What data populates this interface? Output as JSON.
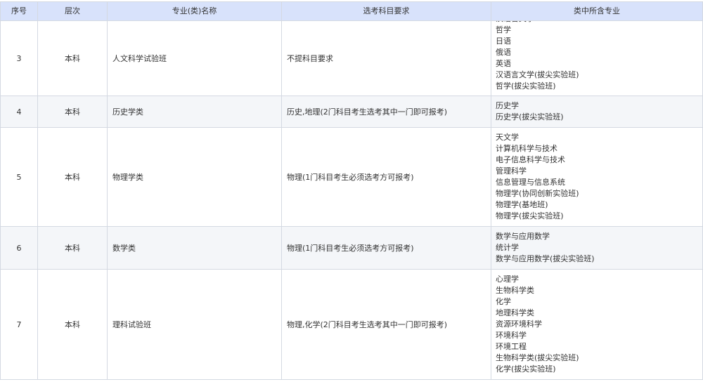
{
  "table": {
    "headers": [
      "序号",
      "层次",
      "专业(类)名称",
      "选考科目要求",
      "类中所含专业"
    ],
    "rows": [
      {
        "no": "3",
        "level": "本科",
        "name": "人文科学试验班",
        "requirement": "不提科目要求",
        "majors": [
          "汉语言文学",
          "哲学",
          "日语",
          "俄语",
          "英语",
          "汉语言文学(拔尖实验班)",
          "哲学(拔尖实验班)"
        ]
      },
      {
        "no": "4",
        "level": "本科",
        "name": "历史学类",
        "requirement": "历史,地理(2门科目考生选考其中一门即可报考)",
        "majors": [
          "历史学",
          "历史学(拔尖实验班)"
        ]
      },
      {
        "no": "5",
        "level": "本科",
        "name": "物理学类",
        "requirement": "物理(1门科目考生必须选考方可报考)",
        "majors": [
          "天文学",
          "计算机科学与技术",
          "电子信息科学与技术",
          "管理科学",
          "信息管理与信息系统",
          "物理学(协同创新实验班)",
          "物理学(基地班)",
          "物理学(拔尖实验班)"
        ]
      },
      {
        "no": "6",
        "level": "本科",
        "name": "数学类",
        "requirement": "物理(1门科目考生必须选考方可报考)",
        "majors": [
          "数学与应用数学",
          "统计学",
          "数学与应用数学(拔尖实验班)"
        ]
      },
      {
        "no": "7",
        "level": "本科",
        "name": "理科试验班",
        "requirement": "物理,化学(2门科目考生选考其中一门即可报考)",
        "majors": [
          "心理学",
          "生物科学类",
          "化学",
          "地理科学类",
          "资源环境科学",
          "环境科学",
          "环境工程",
          "生物科学类(拔尖实验班)",
          "化学(拔尖实验班)"
        ]
      }
    ]
  }
}
